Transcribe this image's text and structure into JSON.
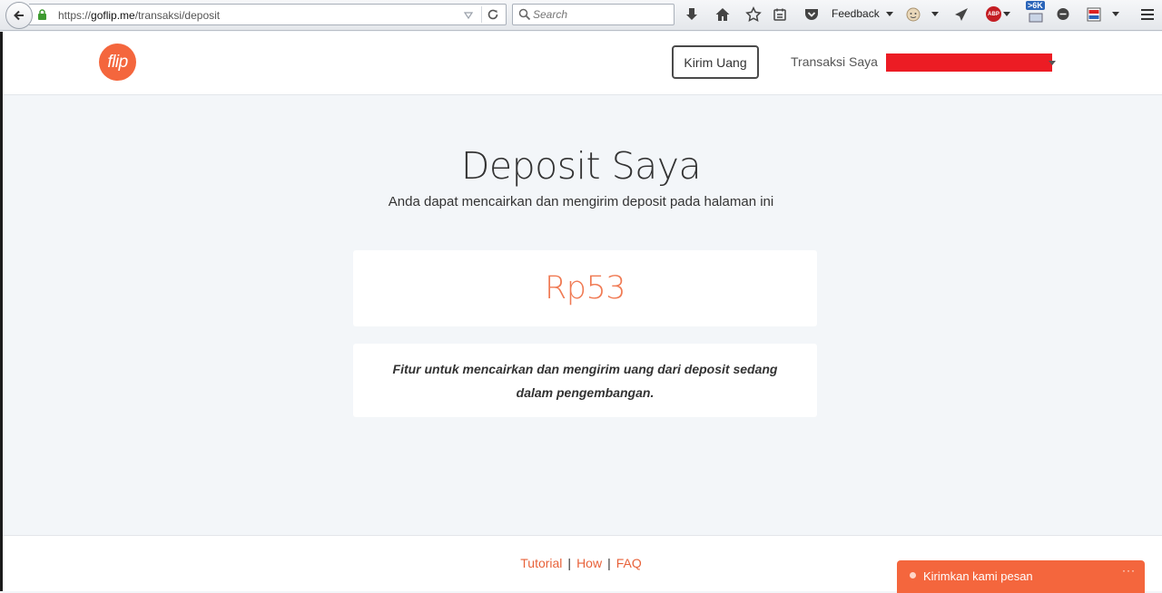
{
  "browser": {
    "url_prefix": "https://",
    "url_domain": "goflip.me",
    "url_path": "/transaksi/deposit",
    "search_placeholder": "Search",
    "feedback_label": "Feedback",
    "abp_label": "ABP",
    "badge_count": ">6K"
  },
  "nav": {
    "logo_text": "flip",
    "kirim_uang_label": "Kirim Uang",
    "transaksi_label": "Transaksi Saya"
  },
  "main": {
    "title": "Deposit Saya",
    "subtitle": "Anda dapat mencairkan dan mengirim deposit pada halaman ini",
    "amount": "Rp53",
    "info": "Fitur untuk mencairkan dan mengirim uang dari deposit sedang dalam pengembangan."
  },
  "footer": {
    "links": [
      "Tutorial",
      "How",
      "FAQ"
    ],
    "separator": "|"
  },
  "chat": {
    "label": "Kirimkan kami pesan",
    "more": "···"
  },
  "colors": {
    "brand": "#f4663d",
    "amount": "#f07a53",
    "page_bg": "#f3f6f9",
    "redaction": "#ec1c24"
  }
}
